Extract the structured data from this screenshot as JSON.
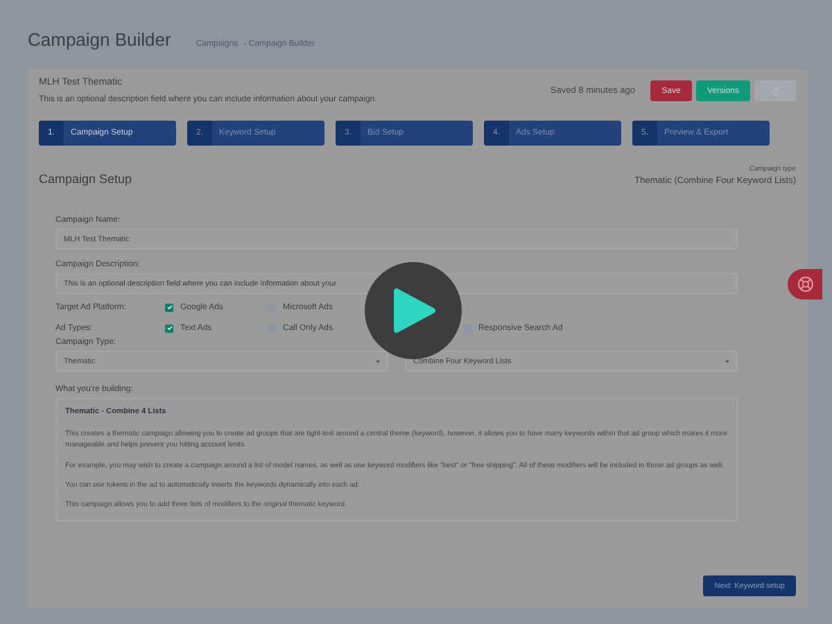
{
  "header": {
    "title": "Campaign Builder",
    "breadcrumbs": [
      "Campaigns",
      "- Campaign Builder"
    ]
  },
  "campaign": {
    "name": "MLH Test Thematic",
    "description": "This is an optional description field where you can include information about your campaign."
  },
  "save_status": "Saved 8 minutes ago",
  "buttons": [
    {
      "kind": "save",
      "label": "Save",
      "disabled": false
    },
    {
      "kind": "versions",
      "label": "Versions",
      "disabled": false
    },
    {
      "kind": "delete",
      "disabled": true
    }
  ],
  "steps": [
    {
      "number": "1.",
      "label": "Campaign Setup",
      "selected": true
    },
    {
      "number": "2.",
      "label": "Keyword Setup",
      "selected": false
    },
    {
      "number": "3.",
      "label": "Bid Setup",
      "selected": false
    },
    {
      "number": "4.",
      "label": "Ads Setup",
      "selected": false
    },
    {
      "number": "5.",
      "label": "Preview & Export",
      "selected": false
    }
  ],
  "section": {
    "title": "Campaign Setup",
    "type_label": "Campaign type",
    "type_value": "Thematic (Combine Four Keyword Lists)"
  },
  "form": {
    "name_label": "Campaign Name:",
    "name_value": "MLH Test Thematic",
    "description_label": "Campaign Description:",
    "description_value": "This is an optional description field where you can include information about your",
    "platform_label": "Target Ad Platform:",
    "platforms": [
      {
        "label": "Google Ads",
        "checked": true
      },
      {
        "label": "Microsoft Ads",
        "checked": false
      }
    ],
    "ad_types_label": "Ad Types:",
    "ad_types": [
      {
        "label": "Text Ads",
        "checked": true
      },
      {
        "label": "Call Only Ads",
        "checked": false
      },
      {
        "label": "Responsive Search Ad",
        "checked": false
      }
    ],
    "campaign_type_label": "Campaign Type:",
    "selects": [
      {
        "value": "Thematic"
      },
      {
        "value": "Combine Four Keyword Lists"
      }
    ],
    "building_label": "What you're building:",
    "info": {
      "title": "Thematic - Combine 4 Lists",
      "paragraphs": [
        "This creates a thematic campaign allowing you to create ad groups that are tight-knit around a central theme (keyword), however, it allows you to have many keywords within that ad group which makes it more manageable and helps prevent you hitting account limits.",
        "For example, you may wish to create a campaign around a list of model names, as well as use keyword modifiers like \"best\" or \"free shipping\". All of these modifiers will be included in those ad groups as well.",
        "You can use tokens in the ad to automatically inserts the keywords dynamically into each ad.",
        "This campaign allows you to add three lists of modifiers to the original thematic keyword."
      ]
    }
  },
  "next_button": "Next: Keyword setup"
}
